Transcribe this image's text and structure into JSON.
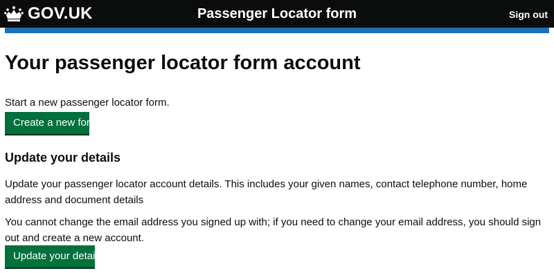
{
  "header": {
    "logo_text": "GOV.UK",
    "service_name": "Passenger Locator form",
    "sign_out_label": "Sign out"
  },
  "main": {
    "heading": "Your passenger locator form account",
    "start_text": "Start a new passenger locator form.",
    "create_button_label": "Create a new form",
    "update_heading": "Update your details",
    "update_text": "Update your passenger locator account details. This includes your given names, contact telephone number, home address and document details",
    "email_text": "You cannot change the email address you signed up with; if you need to change your email address, you should sign out and create a new account.",
    "update_button_label": "Update your details"
  },
  "colors": {
    "header_background": "#0b0c0c",
    "header_bar": "#1d70b8",
    "button_green": "#00703c"
  },
  "icons": {
    "logo": "crown-icon"
  }
}
